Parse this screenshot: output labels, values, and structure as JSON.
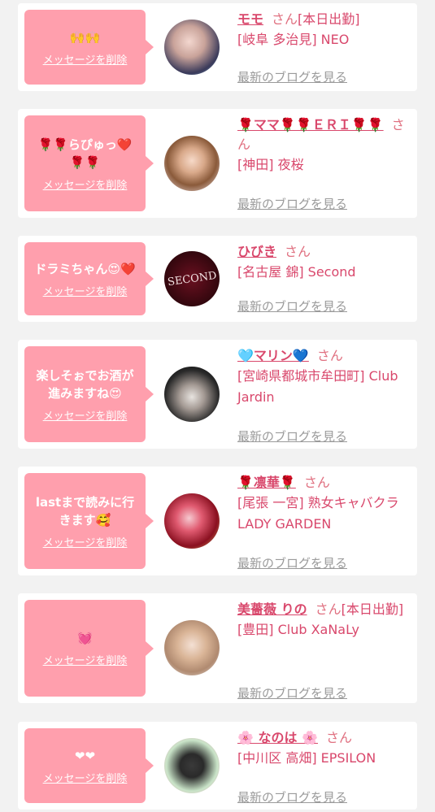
{
  "delete_label": "メッセージを削除",
  "blog_label": "最新のブログを見る",
  "san": "さん",
  "cards": [
    {
      "message": "🙌🙌",
      "name": "モモ",
      "tag": "[本日出勤]",
      "place": "[岐阜 多治見] NEO",
      "avatar": "avatar-1"
    },
    {
      "message": "🌹🌹らぴゅっ❤️🌹🌹",
      "name": "🌹ママ🌹🌹ＥＲＩ🌹🌹",
      "tag": "",
      "place": "[神田] 夜桜",
      "avatar": "avatar-2"
    },
    {
      "message": "ドラミちゃん😍❤️",
      "name": "ひびき",
      "tag": "",
      "place": "[名古屋 錦] Second",
      "avatar": "avatar-3",
      "avatar_text": "SECOND"
    },
    {
      "message": "楽しそぉでお酒が進みますね😍",
      "name": "🩵マリン💙",
      "tag": "",
      "place": "[宮崎県都城市牟田町] Club Jardin",
      "avatar": "avatar-4"
    },
    {
      "message": "lastまで読みに行きます🥰",
      "name": "🌹凛華🌹",
      "tag": "",
      "place": "[尾張 一宮] 熟女キャバクラ LADY GARDEN",
      "avatar": "avatar-5"
    },
    {
      "message": "💓",
      "name": "美薔薇 りの",
      "tag": "[本日出勤]",
      "place": "[豊田] Club XaNaLy",
      "avatar": "avatar-6"
    },
    {
      "message": "❤❤",
      "name": "🌸 なのは 🌸",
      "tag": "",
      "place": "[中川区 高畑] EPSILON",
      "avatar": "avatar-7"
    }
  ]
}
